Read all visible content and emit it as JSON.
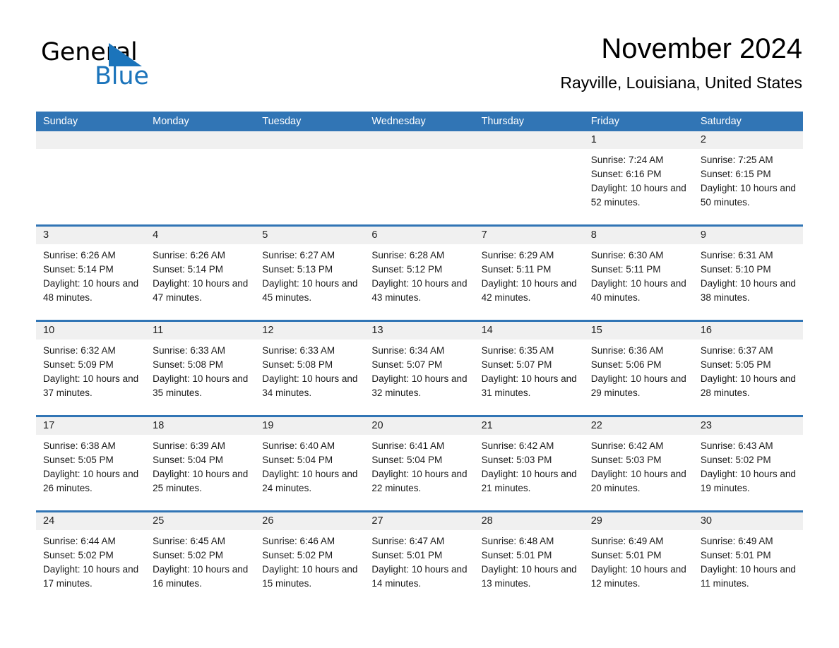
{
  "brand": {
    "name_dark": "General",
    "name_blue": "Blue",
    "logo_color": "#1b74bb"
  },
  "header": {
    "month_title": "November 2024",
    "location": "Rayville, Louisiana, United States"
  },
  "theme": {
    "header_blue": "#3175b5",
    "daynum_gray": "#f0f0f0",
    "text_black": "#000000"
  },
  "calendar": {
    "weekday_headers": [
      "Sunday",
      "Monday",
      "Tuesday",
      "Wednesday",
      "Thursday",
      "Friday",
      "Saturday"
    ],
    "weeks": [
      [
        {
          "day": "",
          "sunrise": "",
          "sunset": "",
          "daylight": ""
        },
        {
          "day": "",
          "sunrise": "",
          "sunset": "",
          "daylight": ""
        },
        {
          "day": "",
          "sunrise": "",
          "sunset": "",
          "daylight": ""
        },
        {
          "day": "",
          "sunrise": "",
          "sunset": "",
          "daylight": ""
        },
        {
          "day": "",
          "sunrise": "",
          "sunset": "",
          "daylight": ""
        },
        {
          "day": "1",
          "sunrise": "Sunrise: 7:24 AM",
          "sunset": "Sunset: 6:16 PM",
          "daylight": "Daylight: 10 hours and 52 minutes."
        },
        {
          "day": "2",
          "sunrise": "Sunrise: 7:25 AM",
          "sunset": "Sunset: 6:15 PM",
          "daylight": "Daylight: 10 hours and 50 minutes."
        }
      ],
      [
        {
          "day": "3",
          "sunrise": "Sunrise: 6:26 AM",
          "sunset": "Sunset: 5:14 PM",
          "daylight": "Daylight: 10 hours and 48 minutes."
        },
        {
          "day": "4",
          "sunrise": "Sunrise: 6:26 AM",
          "sunset": "Sunset: 5:14 PM",
          "daylight": "Daylight: 10 hours and 47 minutes."
        },
        {
          "day": "5",
          "sunrise": "Sunrise: 6:27 AM",
          "sunset": "Sunset: 5:13 PM",
          "daylight": "Daylight: 10 hours and 45 minutes."
        },
        {
          "day": "6",
          "sunrise": "Sunrise: 6:28 AM",
          "sunset": "Sunset: 5:12 PM",
          "daylight": "Daylight: 10 hours and 43 minutes."
        },
        {
          "day": "7",
          "sunrise": "Sunrise: 6:29 AM",
          "sunset": "Sunset: 5:11 PM",
          "daylight": "Daylight: 10 hours and 42 minutes."
        },
        {
          "day": "8",
          "sunrise": "Sunrise: 6:30 AM",
          "sunset": "Sunset: 5:11 PM",
          "daylight": "Daylight: 10 hours and 40 minutes."
        },
        {
          "day": "9",
          "sunrise": "Sunrise: 6:31 AM",
          "sunset": "Sunset: 5:10 PM",
          "daylight": "Daylight: 10 hours and 38 minutes."
        }
      ],
      [
        {
          "day": "10",
          "sunrise": "Sunrise: 6:32 AM",
          "sunset": "Sunset: 5:09 PM",
          "daylight": "Daylight: 10 hours and 37 minutes."
        },
        {
          "day": "11",
          "sunrise": "Sunrise: 6:33 AM",
          "sunset": "Sunset: 5:08 PM",
          "daylight": "Daylight: 10 hours and 35 minutes."
        },
        {
          "day": "12",
          "sunrise": "Sunrise: 6:33 AM",
          "sunset": "Sunset: 5:08 PM",
          "daylight": "Daylight: 10 hours and 34 minutes."
        },
        {
          "day": "13",
          "sunrise": "Sunrise: 6:34 AM",
          "sunset": "Sunset: 5:07 PM",
          "daylight": "Daylight: 10 hours and 32 minutes."
        },
        {
          "day": "14",
          "sunrise": "Sunrise: 6:35 AM",
          "sunset": "Sunset: 5:07 PM",
          "daylight": "Daylight: 10 hours and 31 minutes."
        },
        {
          "day": "15",
          "sunrise": "Sunrise: 6:36 AM",
          "sunset": "Sunset: 5:06 PM",
          "daylight": "Daylight: 10 hours and 29 minutes."
        },
        {
          "day": "16",
          "sunrise": "Sunrise: 6:37 AM",
          "sunset": "Sunset: 5:05 PM",
          "daylight": "Daylight: 10 hours and 28 minutes."
        }
      ],
      [
        {
          "day": "17",
          "sunrise": "Sunrise: 6:38 AM",
          "sunset": "Sunset: 5:05 PM",
          "daylight": "Daylight: 10 hours and 26 minutes."
        },
        {
          "day": "18",
          "sunrise": "Sunrise: 6:39 AM",
          "sunset": "Sunset: 5:04 PM",
          "daylight": "Daylight: 10 hours and 25 minutes."
        },
        {
          "day": "19",
          "sunrise": "Sunrise: 6:40 AM",
          "sunset": "Sunset: 5:04 PM",
          "daylight": "Daylight: 10 hours and 24 minutes."
        },
        {
          "day": "20",
          "sunrise": "Sunrise: 6:41 AM",
          "sunset": "Sunset: 5:04 PM",
          "daylight": "Daylight: 10 hours and 22 minutes."
        },
        {
          "day": "21",
          "sunrise": "Sunrise: 6:42 AM",
          "sunset": "Sunset: 5:03 PM",
          "daylight": "Daylight: 10 hours and 21 minutes."
        },
        {
          "day": "22",
          "sunrise": "Sunrise: 6:42 AM",
          "sunset": "Sunset: 5:03 PM",
          "daylight": "Daylight: 10 hours and 20 minutes."
        },
        {
          "day": "23",
          "sunrise": "Sunrise: 6:43 AM",
          "sunset": "Sunset: 5:02 PM",
          "daylight": "Daylight: 10 hours and 19 minutes."
        }
      ],
      [
        {
          "day": "24",
          "sunrise": "Sunrise: 6:44 AM",
          "sunset": "Sunset: 5:02 PM",
          "daylight": "Daylight: 10 hours and 17 minutes."
        },
        {
          "day": "25",
          "sunrise": "Sunrise: 6:45 AM",
          "sunset": "Sunset: 5:02 PM",
          "daylight": "Daylight: 10 hours and 16 minutes."
        },
        {
          "day": "26",
          "sunrise": "Sunrise: 6:46 AM",
          "sunset": "Sunset: 5:02 PM",
          "daylight": "Daylight: 10 hours and 15 minutes."
        },
        {
          "day": "27",
          "sunrise": "Sunrise: 6:47 AM",
          "sunset": "Sunset: 5:01 PM",
          "daylight": "Daylight: 10 hours and 14 minutes."
        },
        {
          "day": "28",
          "sunrise": "Sunrise: 6:48 AM",
          "sunset": "Sunset: 5:01 PM",
          "daylight": "Daylight: 10 hours and 13 minutes."
        },
        {
          "day": "29",
          "sunrise": "Sunrise: 6:49 AM",
          "sunset": "Sunset: 5:01 PM",
          "daylight": "Daylight: 10 hours and 12 minutes."
        },
        {
          "day": "30",
          "sunrise": "Sunrise: 6:49 AM",
          "sunset": "Sunset: 5:01 PM",
          "daylight": "Daylight: 10 hours and 11 minutes."
        }
      ]
    ]
  }
}
